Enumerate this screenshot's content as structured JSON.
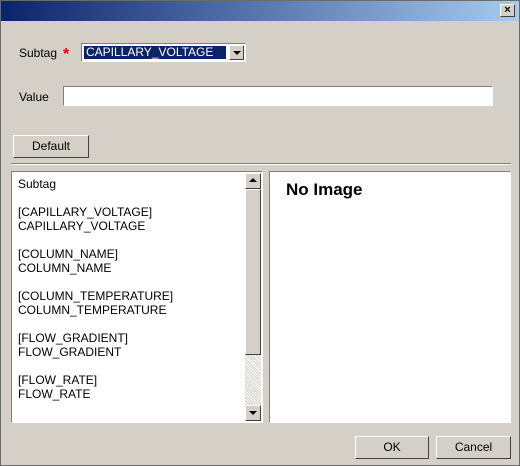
{
  "titlebar": {
    "title": "",
    "close_label": "×"
  },
  "subtag": {
    "label": "Subtag",
    "required_mark": "*",
    "selected_value": "CAPILLARY_VOLTAGE"
  },
  "value_field": {
    "label": "Value",
    "value": ""
  },
  "default_button": {
    "label": "Default"
  },
  "list": {
    "header": "Subtag",
    "items": [
      {
        "code": "[CAPILLARY_VOLTAGE]",
        "name": "CAPILLARY_VOLTAGE"
      },
      {
        "code": "[COLUMN_NAME]",
        "name": "COLUMN_NAME"
      },
      {
        "code": "[COLUMN_TEMPERATURE]",
        "name": "COLUMN_TEMPERATURE"
      },
      {
        "code": "[FLOW_GRADIENT]",
        "name": "FLOW_GRADIENT"
      },
      {
        "code": "[FLOW_RATE]",
        "name": "FLOW_RATE"
      }
    ]
  },
  "image_panel": {
    "placeholder": "No Image"
  },
  "footer": {
    "ok_label": "OK",
    "cancel_label": "Cancel"
  },
  "colors": {
    "title_start": "#0a246a",
    "title_end": "#a6caf0",
    "window_bg": "#d4d0c8",
    "required": "#e00000"
  }
}
